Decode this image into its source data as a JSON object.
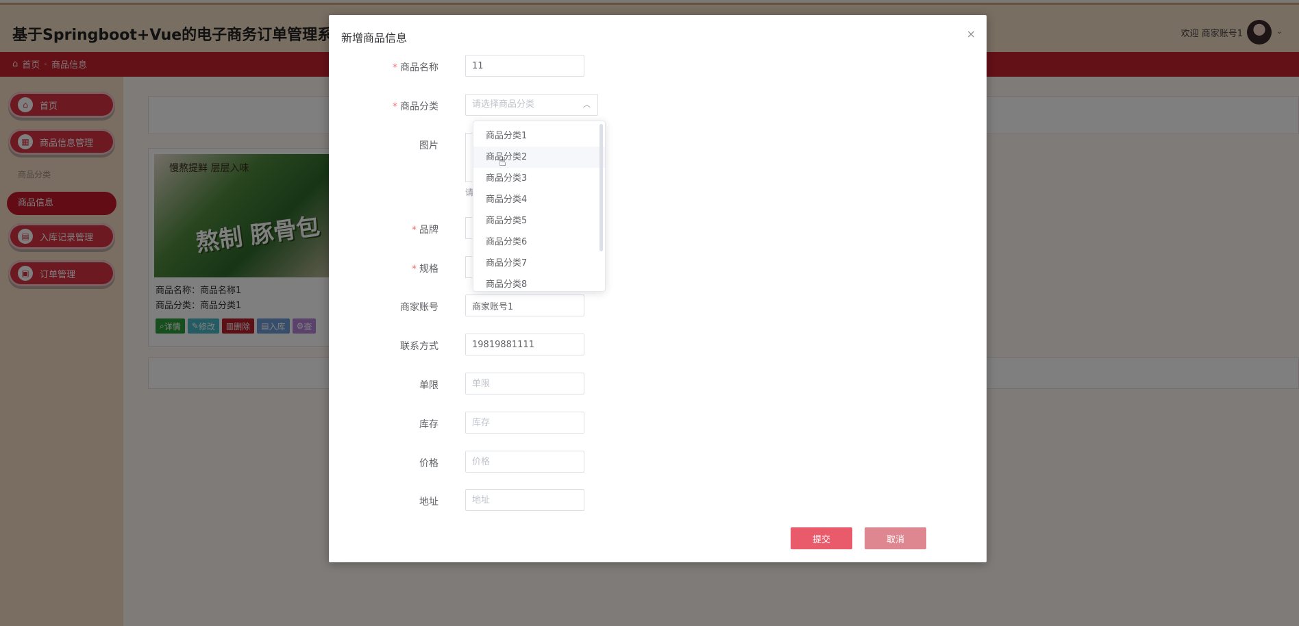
{
  "app": {
    "title": "基于Springboot+Vue的电子商务订单管理系统设",
    "welcome": "欢迎 商家账号1"
  },
  "breadcrumb": {
    "home": "首页",
    "separator": "-",
    "current": "商品信息"
  },
  "sidebar": {
    "items": [
      {
        "label": "首页",
        "icon": "home-icon"
      },
      {
        "label": "商品信息管理",
        "icon": "goods-icon"
      },
      {
        "label": "入库记录管理",
        "icon": "stock-icon"
      },
      {
        "label": "订单管理",
        "icon": "order-icon"
      }
    ],
    "sub_items": [
      "商品分类",
      "商品信息"
    ]
  },
  "card": {
    "image_text_top": "慢熬提鲜 层层入味",
    "image_text_big": "熬制 豚骨包",
    "name_line": "商品名称：商品名称1",
    "category_line": "商品分类：商品分类1",
    "buttons": [
      "详情",
      "修改",
      "删除",
      "入库",
      "查"
    ]
  },
  "dialog": {
    "title": "新增商品信息",
    "close": "×",
    "fields": {
      "name": {
        "label": "商品名称",
        "value": "11",
        "required": true
      },
      "category": {
        "label": "商品分类",
        "placeholder": "请选择商品分类",
        "required": true
      },
      "image": {
        "label": "图片",
        "tip": "请"
      },
      "brand": {
        "label": "品牌",
        "required": true
      },
      "spec": {
        "label": "规格",
        "required": true
      },
      "merchant": {
        "label": "商家账号",
        "value": "商家账号1"
      },
      "contact": {
        "label": "联系方式",
        "value": "19819881111"
      },
      "limit": {
        "label": "单限",
        "placeholder": "单限"
      },
      "stock": {
        "label": "库存",
        "placeholder": "库存"
      },
      "price": {
        "label": "价格",
        "placeholder": "价格"
      },
      "address": {
        "label": "地址",
        "placeholder": "地址"
      }
    },
    "submit": "提交",
    "cancel": "取消"
  },
  "category_options": [
    "商品分类1",
    "商品分类2",
    "商品分类3",
    "商品分类4",
    "商品分类5",
    "商品分类6",
    "商品分类7",
    "商品分类8"
  ],
  "colors": {
    "brand_red": "#c8202e",
    "submit": "#e95b6b",
    "cancel": "#de8790"
  }
}
